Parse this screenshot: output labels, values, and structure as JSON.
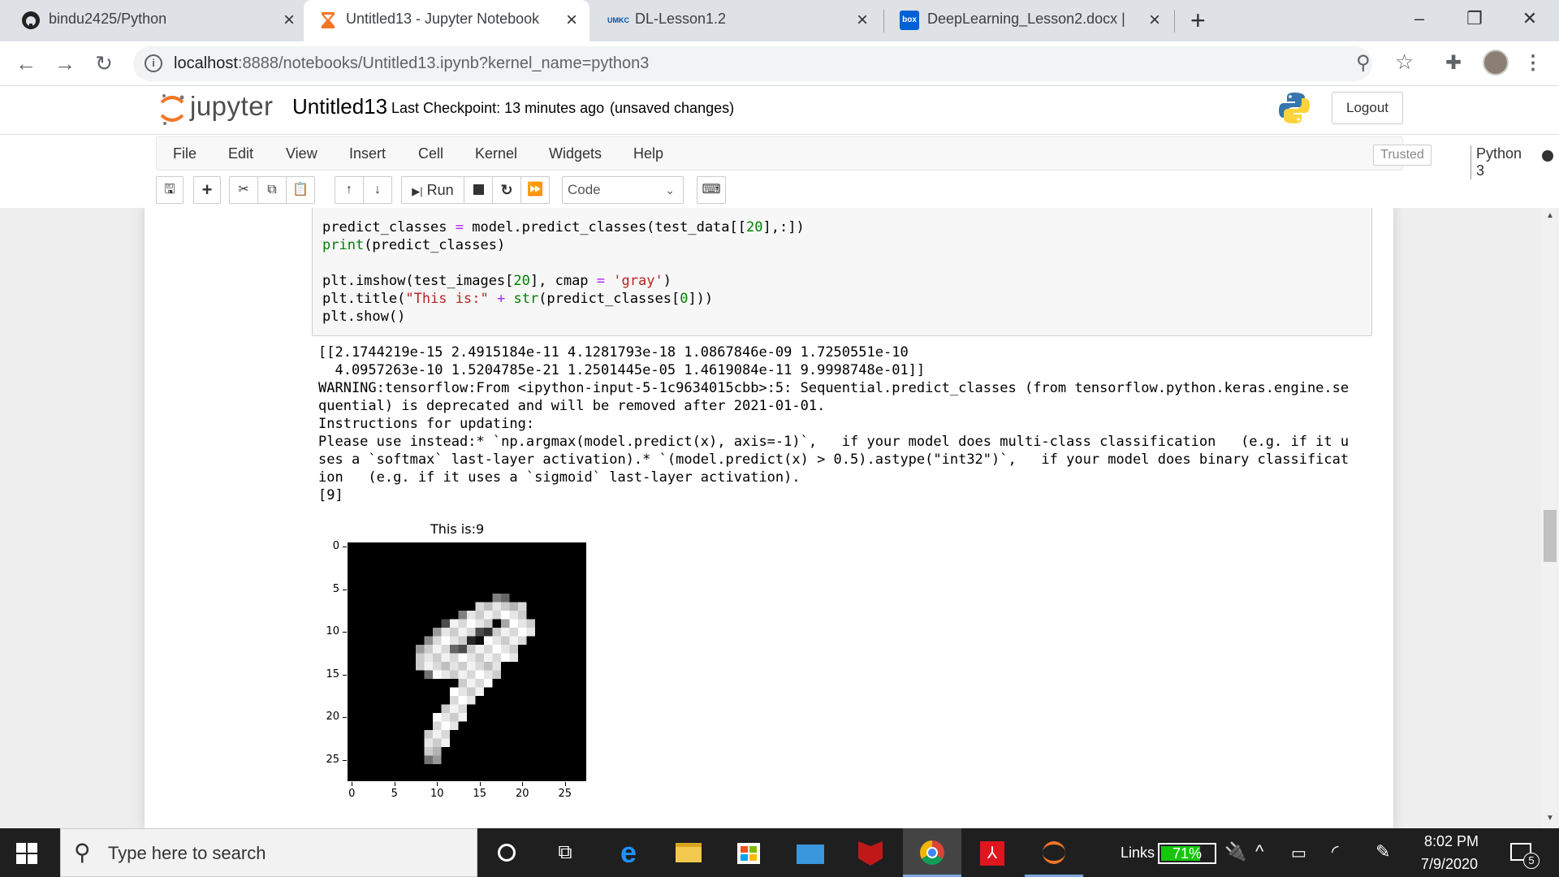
{
  "browser": {
    "tabs": [
      {
        "title": "bindu2425/Python",
        "icon": "github-icon",
        "active": false
      },
      {
        "title": "Untitled13 - Jupyter Notebook",
        "icon": "jupyter-hourglass-icon",
        "active": true
      },
      {
        "title": "DL-Lesson1.2",
        "icon": "unkc-icon",
        "active": false
      },
      {
        "title": "DeepLearning_Lesson2.docx | Po",
        "icon": "box-icon",
        "active": false
      }
    ],
    "new_tab": "+",
    "url_host": "localhost",
    "url_path": ":8888/notebooks/Untitled13.ipynb?kernel_name=python3",
    "favicon_box_text": "box",
    "favicon_unkc_text": "UMKC"
  },
  "jupyter": {
    "logo_text": "jupyter",
    "notebook_name": "Untitled13",
    "checkpoint": "Last Checkpoint: 13 minutes ago",
    "unsaved": "(unsaved changes)",
    "logout": "Logout",
    "menus": [
      "File",
      "Edit",
      "View",
      "Insert",
      "Cell",
      "Kernel",
      "Widgets",
      "Help"
    ],
    "trusted": "Trusted",
    "kernel": "Python 3",
    "run_label": "Run",
    "cell_type": "Code"
  },
  "cell": {
    "code_lines": [
      "predict_classes = model.predict_classes(test_data[[20],:])",
      "print(predict_classes)",
      "",
      "plt.imshow(test_images[20], cmap = 'gray')",
      "plt.title(\"This is:\" + str(predict_classes[0]))",
      "plt.show()"
    ],
    "output_lines": [
      "[[2.1744219e-15 2.4915184e-11 4.1281793e-18 1.0867846e-09 1.7250551e-10",
      "  4.0957263e-10 1.5204785e-21 1.2501445e-05 1.4619084e-11 9.9998748e-01]]",
      "WARNING:tensorflow:From <ipython-input-5-1c9634015cbb>:5: Sequential.predict_classes (from tensorflow.python.keras.engine.se",
      "quential) is deprecated and will be removed after 2021-01-01.",
      "Instructions for updating:",
      "Please use instead:* `np.argmax(model.predict(x), axis=-1)`,   if your model does multi-class classification   (e.g. if it u",
      "ses a `softmax` last-layer activation).* `(model.predict(x) > 0.5).astype(\"int32\")`,   if your model does binary classificat",
      "ion   (e.g. if it uses a `sigmoid` last-layer activation).",
      "[9]"
    ],
    "plot": {
      "title": "This is:9",
      "y_ticks": [
        "0",
        "5",
        "10",
        "15",
        "20",
        "25"
      ],
      "x_ticks": [
        "0",
        "5",
        "10",
        "15",
        "20",
        "25"
      ]
    }
  },
  "taskbar": {
    "search_placeholder": "Type here to search",
    "links_label": "Links",
    "battery": "71%",
    "time": "8:02 PM",
    "date": "7/9/2020",
    "notification_count": "5"
  }
}
